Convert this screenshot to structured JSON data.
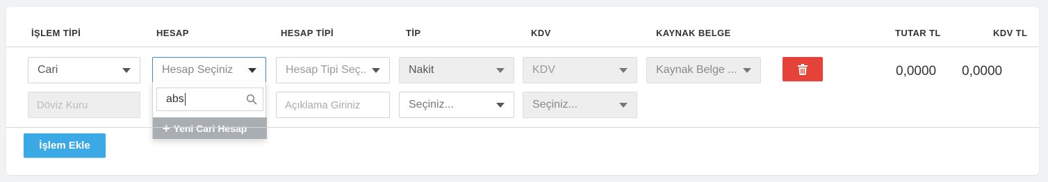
{
  "headers": {
    "islem_tipi": "İŞLEM TİPİ",
    "hesap": "HESAP",
    "hesap_tipi": "HESAP TİPİ",
    "tip": "TİP",
    "kdv": "KDV",
    "kaynak_belge": "KAYNAK BELGE",
    "tutar_tl": "TUTAR TL",
    "kdv_tl": "KDV TL"
  },
  "row": {
    "islem_tipi_value": "Cari",
    "hesap_placeholder": "Hesap Seçiniz",
    "hesap_tipi_placeholder": "Hesap Tipi Seç...",
    "tip_value": "Nakit",
    "kdv_placeholder": "KDV",
    "kaynak_belge_placeholder": "Kaynak Belge ...",
    "doviz_kuru_placeholder": "Döviz Kuru",
    "aciklama_placeholder": "Açıklama Giriniz",
    "tip2_placeholder": "Seçiniz...",
    "kdv2_placeholder": "Seçiniz...",
    "tutar_tl": "0,0000",
    "kdv_tl": "0,0000"
  },
  "dropdown": {
    "search_value": "abs",
    "new_account_label": "Yeni Cari Hesap"
  },
  "buttons": {
    "add_label": "İşlem Ekle"
  },
  "icons": {
    "delete": "trash-icon",
    "search": "search-icon",
    "new": "plus-icon",
    "caret": "caret-down-icon"
  },
  "colors": {
    "delete_button": "#e5433a",
    "add_button": "#3aa9e6",
    "focus_border": "#3f89d6",
    "new_item_bg": "#a9aeb3"
  }
}
